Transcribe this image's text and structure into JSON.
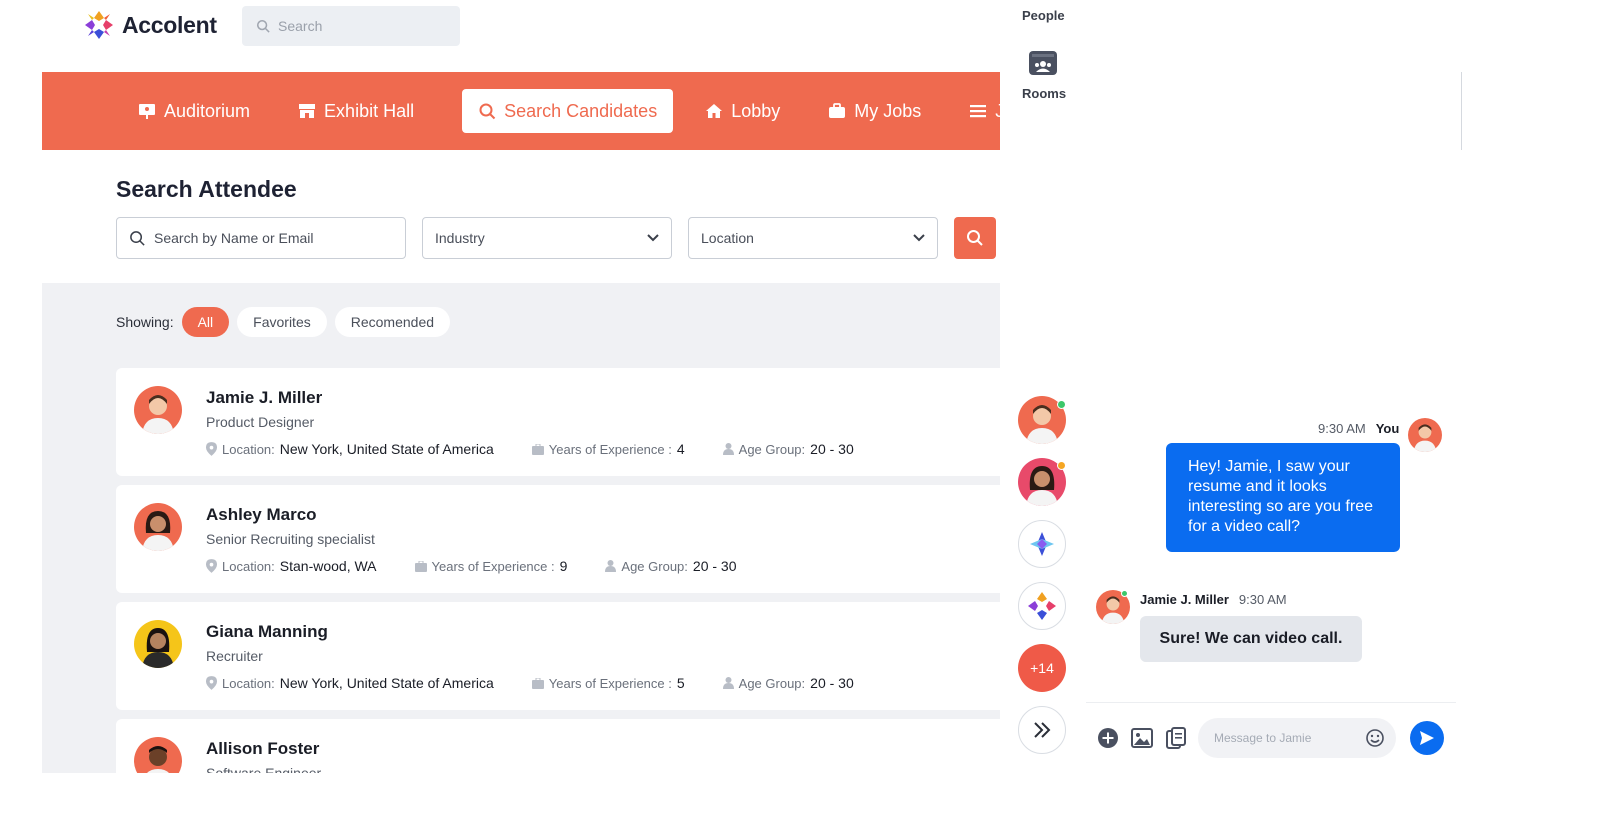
{
  "brand": {
    "name": "Accolent"
  },
  "top_search": {
    "placeholder": "Search"
  },
  "nav": {
    "items": [
      {
        "label": "Auditorium",
        "icon": "presentation-icon"
      },
      {
        "label": "Exhibit Hall",
        "icon": "store-icon"
      },
      {
        "label": "Search Candidates",
        "icon": "search-icon",
        "active": true
      },
      {
        "label": "Lobby",
        "icon": "home-icon"
      },
      {
        "label": "My Jobs",
        "icon": "briefcase-icon"
      },
      {
        "label": "J",
        "icon": "menu-icon"
      }
    ]
  },
  "search_attendee": {
    "title": "Search Attendee",
    "name_placeholder": "Search by Name or Email",
    "industry_label": "Industry",
    "location_label": "Location"
  },
  "showing": {
    "label": "Showing:",
    "filters": [
      "All",
      "Favorites",
      "Recomended"
    ]
  },
  "candidates": [
    {
      "name": "Jamie J. Miller",
      "role": "Product Designer",
      "location_label": "Location:",
      "location": "New York, United State of America",
      "experience_label": "Years of Experience :",
      "experience": "4",
      "age_label": "Age Group:",
      "age": "20 - 30"
    },
    {
      "name": "Ashley Marco",
      "role": "Senior Recruiting specialist",
      "location_label": "Location:",
      "location": "Stan-wood, WA",
      "experience_label": "Years of Experience :",
      "experience": "9",
      "age_label": "Age Group:",
      "age": "20 - 30"
    },
    {
      "name": "Giana Manning",
      "role": "Recruiter",
      "location_label": "Location:",
      "location": "New York, United State of America",
      "experience_label": "Years of Experience :",
      "experience": "5",
      "age_label": "Age Group:",
      "age": "20 - 30"
    },
    {
      "name": "Allison Foster",
      "role": "Software Engineer"
    }
  ],
  "chat": {
    "people_label": "People",
    "rooms_label": "Rooms",
    "unread_count": "+14",
    "outgoing": {
      "time": "9:30 AM",
      "author": "You",
      "text": "Hey! Jamie, I saw your resume and it looks interesting so are you free for a video call?"
    },
    "incoming": {
      "author": "Jamie J. Miller",
      "time": "9:30 AM",
      "text": "Sure! We can video call."
    },
    "composer_placeholder": "Message to Jamie"
  },
  "colors": {
    "accent": "#ef6a4f",
    "chat_blue": "#0a6cf0",
    "online": "#3cc76a",
    "away": "#f5a623"
  }
}
